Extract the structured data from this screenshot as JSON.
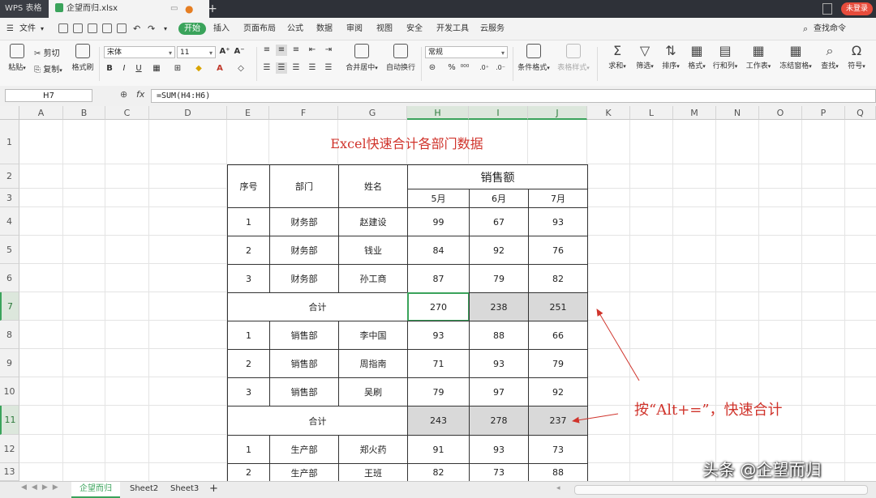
{
  "titlebar": {
    "app_tab": "WPS 表格",
    "file_tab": "企望而归.xlsx",
    "new_tab": "+",
    "login_label": "未登录"
  },
  "menubar": {
    "file_label": "文件",
    "tabs": [
      "开始",
      "插入",
      "页面布局",
      "公式",
      "数据",
      "审阅",
      "视图",
      "安全",
      "开发工具",
      "云服务"
    ],
    "search_label": "查找命令"
  },
  "ribbon": {
    "paste": "粘贴",
    "cut": "剪切",
    "copy": "复制",
    "format_painter": "格式刷",
    "font_name": "宋体",
    "font_size": "11",
    "number_format": "常规",
    "merge_center": "合并居中",
    "wrap_text": "自动换行",
    "conditional_format": "条件格式",
    "table_style": "表格样式",
    "sum": "求和",
    "filter": "筛选",
    "sort": "排序",
    "format": "格式",
    "row_col": "行和列",
    "worksheet": "工作表",
    "freeze": "冻结窗格",
    "find": "查找",
    "symbol": "符号"
  },
  "formula_bar": {
    "name_box": "H7",
    "fx": "fx",
    "formula": "=SUM(H4:H6)"
  },
  "columns": [
    "A",
    "B",
    "C",
    "D",
    "E",
    "F",
    "G",
    "H",
    "I",
    "J",
    "K",
    "L",
    "M",
    "N",
    "O",
    "P",
    "Q"
  ],
  "rows": [
    "1",
    "2",
    "3",
    "4",
    "5",
    "6",
    "7",
    "8",
    "9",
    "10",
    "11",
    "12",
    "13"
  ],
  "sheet": {
    "title": "Excel快速合计各部门数据",
    "headers": {
      "seq": "序号",
      "dept": "部门",
      "name": "姓名",
      "sales": "销售额",
      "months": [
        "5月",
        "6月",
        "7月"
      ]
    },
    "groups": [
      {
        "rows": [
          {
            "seq": "1",
            "dept": "财务部",
            "name": "赵建设",
            "values": [
              "99",
              "67",
              "93"
            ]
          },
          {
            "seq": "2",
            "dept": "财务部",
            "name": "钱业",
            "values": [
              "84",
              "92",
              "76"
            ]
          },
          {
            "seq": "3",
            "dept": "财务部",
            "name": "孙工商",
            "values": [
              "87",
              "79",
              "82"
            ]
          }
        ],
        "total_label": "合计",
        "totals": [
          "270",
          "238",
          "251"
        ]
      },
      {
        "rows": [
          {
            "seq": "1",
            "dept": "销售部",
            "name": "李中国",
            "values": [
              "93",
              "88",
              "66"
            ]
          },
          {
            "seq": "2",
            "dept": "销售部",
            "name": "周指南",
            "values": [
              "71",
              "93",
              "79"
            ]
          },
          {
            "seq": "3",
            "dept": "销售部",
            "name": "吴刷",
            "values": [
              "79",
              "97",
              "92"
            ]
          }
        ],
        "total_label": "合计",
        "totals": [
          "243",
          "278",
          "237"
        ]
      },
      {
        "rows": [
          {
            "seq": "1",
            "dept": "生产部",
            "name": "郑火药",
            "values": [
              "91",
              "93",
              "73"
            ]
          },
          {
            "seq": "2",
            "dept": "生产部",
            "name": "王班",
            "values": [
              "82",
              "73",
              "88"
            ]
          }
        ]
      }
    ]
  },
  "annotation": "按“Alt+=”，快速合计",
  "watermark": "头条 @企望而归",
  "sheet_tabs": [
    "企望而归",
    "Sheet2",
    "Sheet3"
  ],
  "add_sheet": "+",
  "colors": {
    "accent": "#3aa35b",
    "title_red": "#d0342c",
    "sum_fill": "#d9d9d9"
  }
}
